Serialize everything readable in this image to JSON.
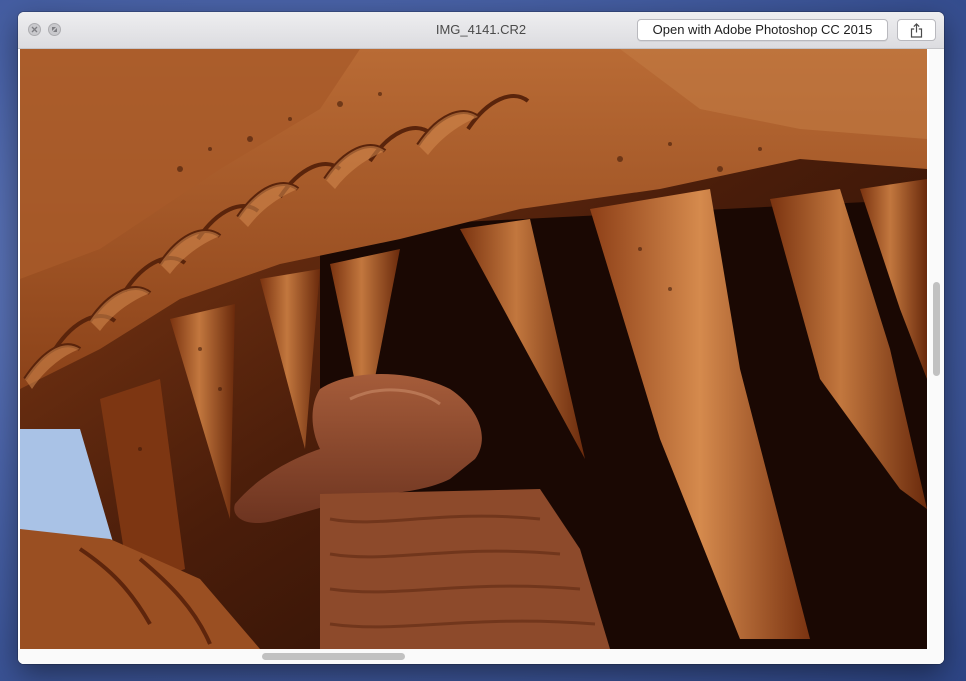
{
  "window": {
    "title": "IMG_4141.CR2",
    "open_button_label": "Open with Adobe Photoshop CC 2015",
    "share_icon": "share-icon"
  },
  "preview": {
    "image_description_icon": "photo-image",
    "vertical_scroll_position": 0.39,
    "horizontal_scroll_position": 0.27
  },
  "colors": {
    "rust": "#b5652c",
    "dark": "#2a0f05",
    "sky": "#a9c2e6"
  }
}
